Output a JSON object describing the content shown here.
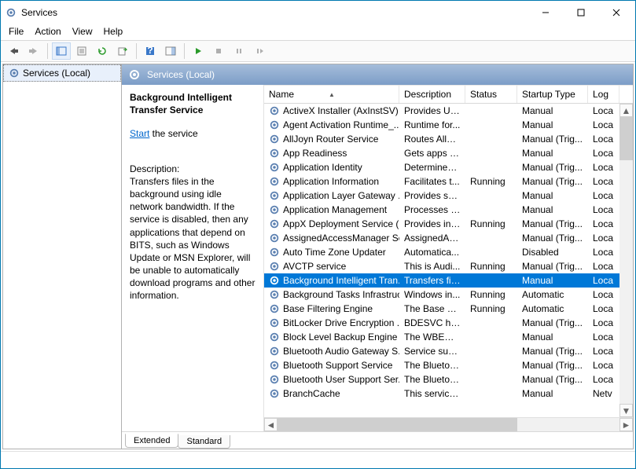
{
  "window": {
    "title": "Services"
  },
  "menu": {
    "file": "File",
    "action": "Action",
    "view": "View",
    "help": "Help"
  },
  "tree": {
    "root": "Services (Local)"
  },
  "panel": {
    "heading": "Services (Local)",
    "selected_name": "Background Intelligent Transfer Service",
    "start_link": "Start",
    "start_suffix": " the service",
    "description_label": "Description:",
    "description": "Transfers files in the background using idle network bandwidth. If the service is disabled, then any applications that depend on BITS, such as Windows Update or MSN Explorer, will be unable to automatically download programs and other information."
  },
  "columns": {
    "name": "Name",
    "description": "Description",
    "status": "Status",
    "startup": "Startup Type",
    "logon": "Log"
  },
  "tabs": {
    "extended": "Extended",
    "standard": "Standard"
  },
  "services": [
    {
      "name": "ActiveX Installer (AxInstSV)",
      "desc": "Provides Us...",
      "status": "",
      "startup": "Manual",
      "logon": "Loca"
    },
    {
      "name": "Agent Activation Runtime_...",
      "desc": "Runtime for...",
      "status": "",
      "startup": "Manual",
      "logon": "Loca"
    },
    {
      "name": "AllJoyn Router Service",
      "desc": "Routes AllJo...",
      "status": "",
      "startup": "Manual (Trig...",
      "logon": "Loca"
    },
    {
      "name": "App Readiness",
      "desc": "Gets apps re...",
      "status": "",
      "startup": "Manual",
      "logon": "Loca"
    },
    {
      "name": "Application Identity",
      "desc": "Determines ...",
      "status": "",
      "startup": "Manual (Trig...",
      "logon": "Loca"
    },
    {
      "name": "Application Information",
      "desc": "Facilitates t...",
      "status": "Running",
      "startup": "Manual (Trig...",
      "logon": "Loca"
    },
    {
      "name": "Application Layer Gateway ...",
      "desc": "Provides su...",
      "status": "",
      "startup": "Manual",
      "logon": "Loca"
    },
    {
      "name": "Application Management",
      "desc": "Processes in...",
      "status": "",
      "startup": "Manual",
      "logon": "Loca"
    },
    {
      "name": "AppX Deployment Service (...",
      "desc": "Provides inf...",
      "status": "Running",
      "startup": "Manual (Trig...",
      "logon": "Loca"
    },
    {
      "name": "AssignedAccessManager Se...",
      "desc": "AssignedAc...",
      "status": "",
      "startup": "Manual (Trig...",
      "logon": "Loca"
    },
    {
      "name": "Auto Time Zone Updater",
      "desc": "Automatica...",
      "status": "",
      "startup": "Disabled",
      "logon": "Loca"
    },
    {
      "name": "AVCTP service",
      "desc": "This is Audi...",
      "status": "Running",
      "startup": "Manual (Trig...",
      "logon": "Loca"
    },
    {
      "name": "Background Intelligent Tran...",
      "desc": "Transfers fil...",
      "status": "",
      "startup": "Manual",
      "logon": "Loca",
      "selected": true
    },
    {
      "name": "Background Tasks Infrastruc...",
      "desc": "Windows in...",
      "status": "Running",
      "startup": "Automatic",
      "logon": "Loca"
    },
    {
      "name": "Base Filtering Engine",
      "desc": "The Base Fil...",
      "status": "Running",
      "startup": "Automatic",
      "logon": "Loca"
    },
    {
      "name": "BitLocker Drive Encryption ...",
      "desc": "BDESVC hos...",
      "status": "",
      "startup": "Manual (Trig...",
      "logon": "Loca"
    },
    {
      "name": "Block Level Backup Engine ...",
      "desc": "The WBENG...",
      "status": "",
      "startup": "Manual",
      "logon": "Loca"
    },
    {
      "name": "Bluetooth Audio Gateway S...",
      "desc": "Service sup...",
      "status": "",
      "startup": "Manual (Trig...",
      "logon": "Loca"
    },
    {
      "name": "Bluetooth Support Service",
      "desc": "The Bluetoo...",
      "status": "",
      "startup": "Manual (Trig...",
      "logon": "Loca"
    },
    {
      "name": "Bluetooth User Support Ser...",
      "desc": "The Bluetoo...",
      "status": "",
      "startup": "Manual (Trig...",
      "logon": "Loca"
    },
    {
      "name": "BranchCache",
      "desc": "This service ...",
      "status": "",
      "startup": "Manual",
      "logon": "Netv"
    }
  ]
}
